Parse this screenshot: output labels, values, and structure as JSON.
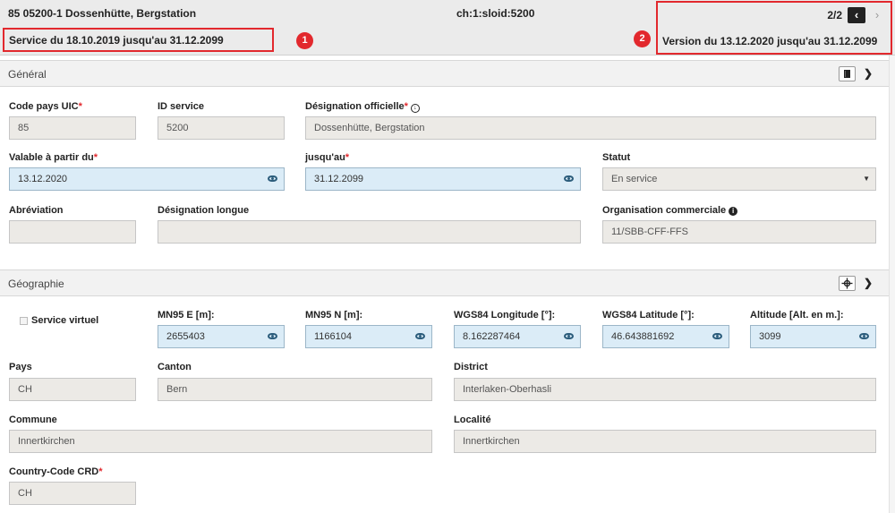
{
  "header": {
    "title": "85 05200-1 Dossenhütte, Bergstation",
    "sloid": "ch:1:sloid:5200",
    "service_period": "Service du 18.10.2019 jusqu'au 31.12.2099",
    "version_period": "Version du 13.12.2020 jusqu'au 31.12.2099",
    "pager": "2/2",
    "prev_icon": "chevron-left-icon",
    "next_icon": "chevron-right-icon",
    "annotation_1": "1",
    "annotation_2": "2",
    "annotation_color": "#e2282d"
  },
  "general": {
    "title": "Général",
    "fields": {
      "uic_country_code": {
        "label": "Code pays UIC",
        "value": "85"
      },
      "service_id": {
        "label": "ID service",
        "value": "5200"
      },
      "official_name": {
        "label": "Désignation officielle",
        "value": "Dossenhütte, Bergstation"
      },
      "valid_from": {
        "label": "Valable à partir du",
        "value": "13.12.2020"
      },
      "valid_to": {
        "label": "jusqu'au",
        "value": "31.12.2099"
      },
      "status": {
        "label": "Statut",
        "value": "En service"
      },
      "abbreviation": {
        "label": "Abréviation",
        "value": ""
      },
      "long_name": {
        "label": "Désignation longue",
        "value": ""
      },
      "business_org": {
        "label": "Organisation commerciale",
        "value": "11/SBB-CFF-FFS"
      }
    }
  },
  "geography": {
    "title": "Géographie",
    "virtual_service": "Service virtuel",
    "fields": {
      "mn95_e": {
        "label": "MN95 E [m]:",
        "value": "2655403"
      },
      "mn95_n": {
        "label": "MN95 N [m]:",
        "value": "1166104"
      },
      "wgs84_lon": {
        "label": "WGS84 Longitude [°]:",
        "value": "8.162287464"
      },
      "wgs84_lat": {
        "label": "WGS84 Latitude [°]:",
        "value": "46.643881692"
      },
      "altitude": {
        "label": "Altitude [Alt. en m.]:",
        "value": "3099"
      },
      "country": {
        "label": "Pays",
        "value": "CH"
      },
      "canton": {
        "label": "Canton",
        "value": "Bern"
      },
      "district": {
        "label": "District",
        "value": "Interlaken-Oberhasli"
      },
      "commune": {
        "label": "Commune",
        "value": "Innertkirchen"
      },
      "locality": {
        "label": "Localité",
        "value": "Innertkirchen"
      },
      "country_code_crd": {
        "label": "Country-Code CRD",
        "value": "CH"
      }
    }
  }
}
